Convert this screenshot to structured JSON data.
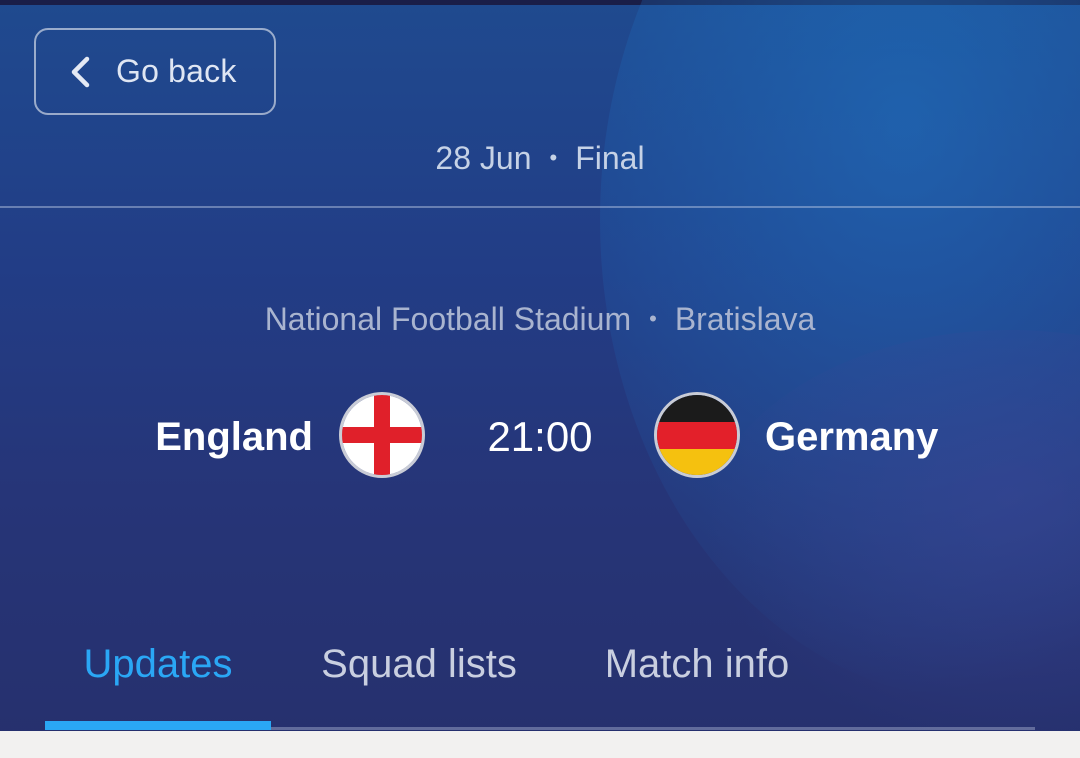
{
  "header": {
    "back_label": "Go back"
  },
  "match": {
    "date": "28 Jun",
    "stage": "Final",
    "separator": "•",
    "venue": "National Football Stadium",
    "city": "Bratislava",
    "kickoff": "21:00",
    "home_team": {
      "name": "England",
      "flag_icon": "england-flag-icon"
    },
    "away_team": {
      "name": "Germany",
      "flag_icon": "germany-flag-icon"
    }
  },
  "tabs": [
    {
      "label": "Updates",
      "active": true
    },
    {
      "label": "Squad lists",
      "active": false
    },
    {
      "label": "Match info",
      "active": false
    }
  ],
  "colors": {
    "accent": "#2aa7f5",
    "background": "#243a80",
    "text": "#ffffff"
  }
}
